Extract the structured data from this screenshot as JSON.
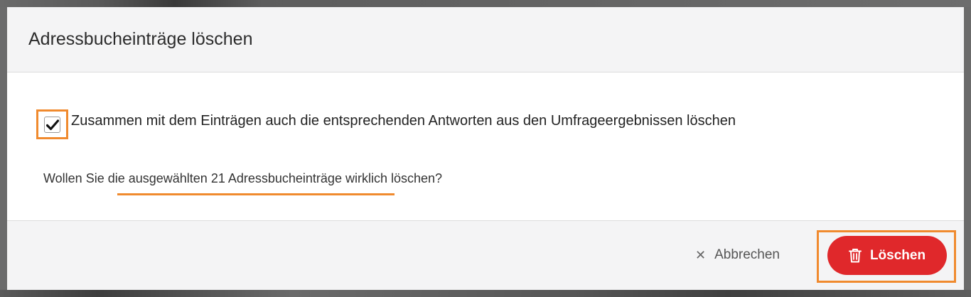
{
  "dialog": {
    "title": "Adressbucheinträge löschen",
    "checkbox": {
      "checked": true,
      "label": "Zusammen mit dem Einträgen auch die entsprechenden Antworten aus den Umfrageergebnissen löschen"
    },
    "question": "Wollen Sie die ausgewählten 21 Adressbucheinträge wirklich löschen?",
    "buttons": {
      "cancel_label": "Abbrechen",
      "cancel_icon": "close-icon",
      "delete_label": "Löschen",
      "delete_icon": "trash-icon"
    }
  },
  "colors": {
    "delete_button": "#e0282b",
    "highlight": "#f08a2e",
    "header_bg": "#f4f4f5"
  }
}
